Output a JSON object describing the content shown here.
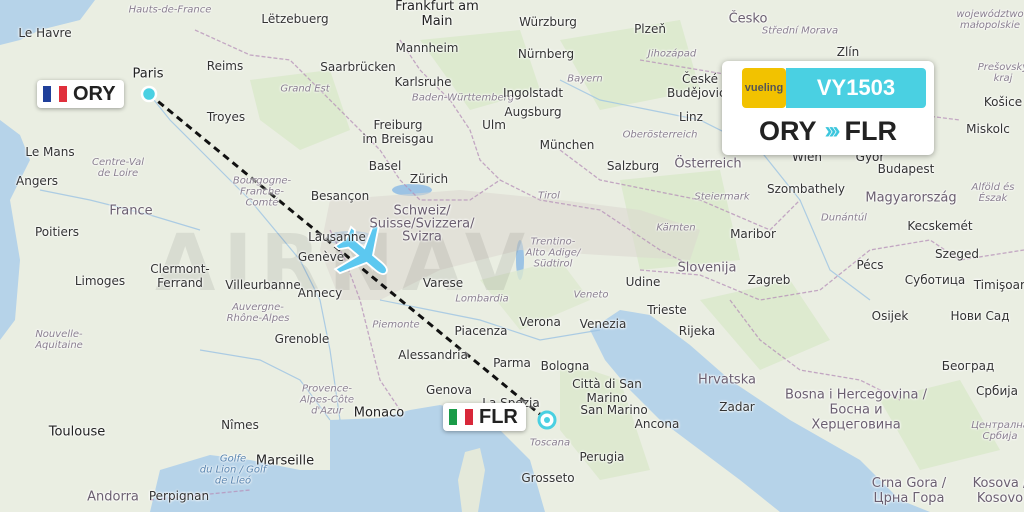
{
  "watermark": "AIRNAV",
  "origin": {
    "code": "ORY",
    "city": "Paris"
  },
  "destination": {
    "code": "FLR"
  },
  "flight": {
    "airline_logo": "vueling",
    "number": "VY1503",
    "from": "ORY",
    "to": "FLR",
    "arrows": "›››"
  },
  "colors": {
    "route_line": "#111111",
    "airport_marker": "#4ad0e2",
    "plane": "#5cc8f0",
    "flight_number_bg": "#4ad0e2",
    "logo_bg": "#f2c200"
  },
  "icons": {
    "plane": "plane-icon",
    "france_flag": "france-flag-icon",
    "italy_flag": "italy-flag-icon"
  },
  "map_labels": {
    "hauts_de_france": "Hauts-de-France",
    "letzebuerg": "Lëtzebuerg",
    "frankfurt": "Frankfurt am\nMain",
    "wurzburg": "Würzburg",
    "plzen": "Plzeň",
    "cesko": "Česko",
    "morava": "Střední Morava",
    "jihozapad": "Jihozápad",
    "zlin": "Zlín",
    "wojewodztwo": "województwo\nmałopolskie",
    "le_havre": "Le Havre",
    "paris": "Paris",
    "reims": "Reims",
    "mannheim": "Mannheim",
    "nurnberg": "Nürnberg",
    "saarbrucken": "Saarbrücken",
    "karlsruhe": "Karlsruhe",
    "bayern": "Bayern",
    "ceske": "České\nBudějovice",
    "presovsky": "Prešovský\nkraj",
    "grand_est": "Grand Est",
    "baden": "Baden-Württemberg",
    "ingolstadt": "Ingolstadt",
    "augsburg": "Augsburg",
    "linz": "Linz",
    "kosice": "Košice",
    "troyes": "Troyes",
    "freiburg": "Freiburg\nim Breisgau",
    "ulm": "Ulm",
    "oberosterreich": "Oberösterreich",
    "miskolc": "Miskolc",
    "le_mans": "Le Mans",
    "munchen": "München",
    "wien": "Wien",
    "gyor": "Győr",
    "angers": "Angers",
    "centre": "Centre-Val\nde Loire",
    "basel": "Basel",
    "zurich": "Zürich",
    "salzburg": "Salzburg",
    "osterreich": "Österreich",
    "budapest": "Budapest",
    "alfold": "Alföld és\nÉszak",
    "bourgogne": "Bourgogne-\nFranche-\nComté",
    "besancon": "Besançon",
    "tirol": "Tirol",
    "szombathely": "Szombathely",
    "france": "France",
    "schweiz": "Schweiz/\nSuisse/Svizzera/\nSvizra",
    "steiermark": "Steiermark",
    "magyarorszag": "Magyarország",
    "poitiers": "Poitiers",
    "lausanne": "Lausanne",
    "trentino": "Trentino-\nAlto Adige/\nSüdtirol",
    "karnten": "Kärnten",
    "maribor": "Maribor",
    "dunantul": "Dunántúl",
    "kecskemet": "Kecskemét",
    "geneve": "Genève",
    "varese": "Varese",
    "slovenija": "Slovenija",
    "zagreb": "Zagreb",
    "szeged": "Szeged",
    "clermont": "Clermont-\nFerrand",
    "limoges": "Limoges",
    "villeurbanne": "Villeurbanne",
    "annecy": "Annecy",
    "pecs": "Pécs",
    "subotica": "Суботица",
    "timisoara": "Timişoara",
    "lombardia": "Lombardia",
    "veneto": "Veneto",
    "udine": "Udine",
    "auvergne": "Auvergne-\nRhône-Alpes",
    "trieste": "Trieste",
    "osijek": "Osijek",
    "novi_sad": "Нови Сад",
    "nouvelle": "Nouvelle-\nAquitaine",
    "piacenza": "Piacenza",
    "verona": "Verona",
    "venezia": "Venezia",
    "rijeka": "Rijeka",
    "piemonte": "Piemonte",
    "grenoble": "Grenoble",
    "beograd": "Београд",
    "alessandria": "Alessandria",
    "parma": "Parma",
    "bologna": "Bologna",
    "citta_san_marino": "Città di San\nMarino",
    "hrvatska": "Hrvatska",
    "srbija": "Србија",
    "provence": "Provence-\nAlpes-Côte\nd'Azur",
    "genova": "Genova",
    "san_marino": "San Marino",
    "zadar": "Zadar",
    "bosna": "Bosna i Hercegovina /\nБосна и\nХерцеговина",
    "monaco": "Monaco",
    "la_spezia": "La Spezia",
    "toulouse": "Toulouse",
    "nimes": "Nîmes",
    "ancona": "Ancona",
    "centralna": "Централна\nСрбија",
    "toscana": "Toscana",
    "perugia": "Perugia",
    "marseille": "Marseille",
    "golfe": "Golfe\ndu Lion / Golf\nde Lleó",
    "crna_gora": "Crna Gora /\nЦрна Гора",
    "kosovo": "Kosova /\nKosovo",
    "andorra": "Andorra",
    "perpignan": "Perpignan",
    "grosseto": "Grosseto"
  }
}
